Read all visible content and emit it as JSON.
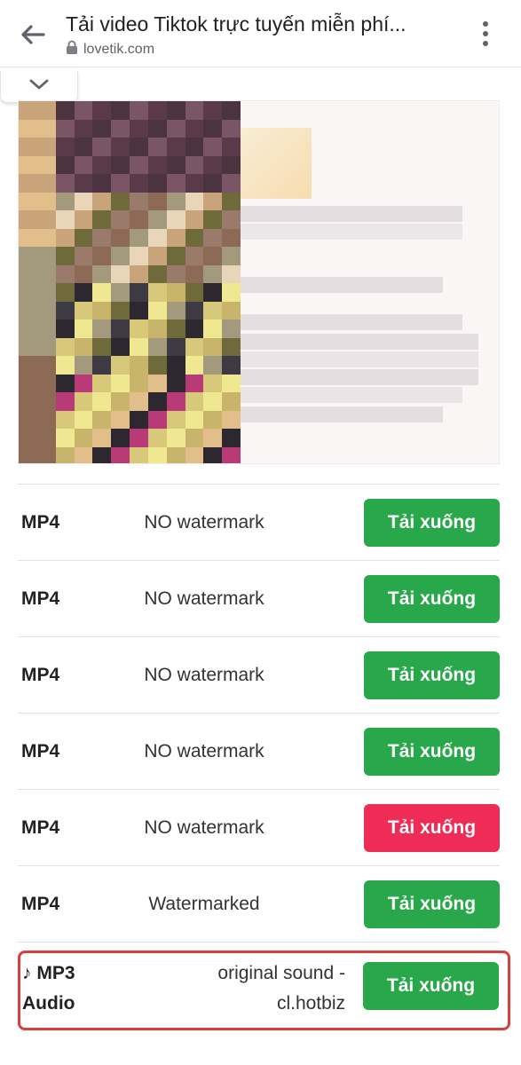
{
  "browser": {
    "title": "Tải video Tiktok trực tuyến miễn phí...",
    "url": "lovetik.com"
  },
  "thumbnail": {
    "description_colors": {
      "left_panel": "#6b4a5a",
      "right_panel": "#fbf6f6"
    }
  },
  "downloads": [
    {
      "format": "MP4",
      "label": "NO watermark",
      "button": "Tải xuống",
      "color": "#28a84a"
    },
    {
      "format": "MP4",
      "label": "NO watermark",
      "button": "Tải xuống",
      "color": "#28a84a"
    },
    {
      "format": "MP4",
      "label": "NO watermark",
      "button": "Tải xuống",
      "color": "#28a84a"
    },
    {
      "format": "MP4",
      "label": "NO watermark",
      "button": "Tải xuống",
      "color": "#28a84a"
    },
    {
      "format": "MP4",
      "label": "NO watermark",
      "button": "Tải xuống",
      "color": "#ee2c55"
    },
    {
      "format": "MP4",
      "label": "Watermarked",
      "button": "Tải xuống",
      "color": "#28a84a"
    }
  ],
  "audio": {
    "format_line1": "♪ MP3",
    "format_line2": "Audio",
    "label_line1": "original sound -",
    "label_line2": "cl.hotbiz",
    "button": "Tải xuống"
  },
  "icons": {
    "back": "arrow-left-icon",
    "lock": "lock-icon",
    "menu": "more-vertical-icon",
    "collapse": "chevron-down-icon"
  }
}
